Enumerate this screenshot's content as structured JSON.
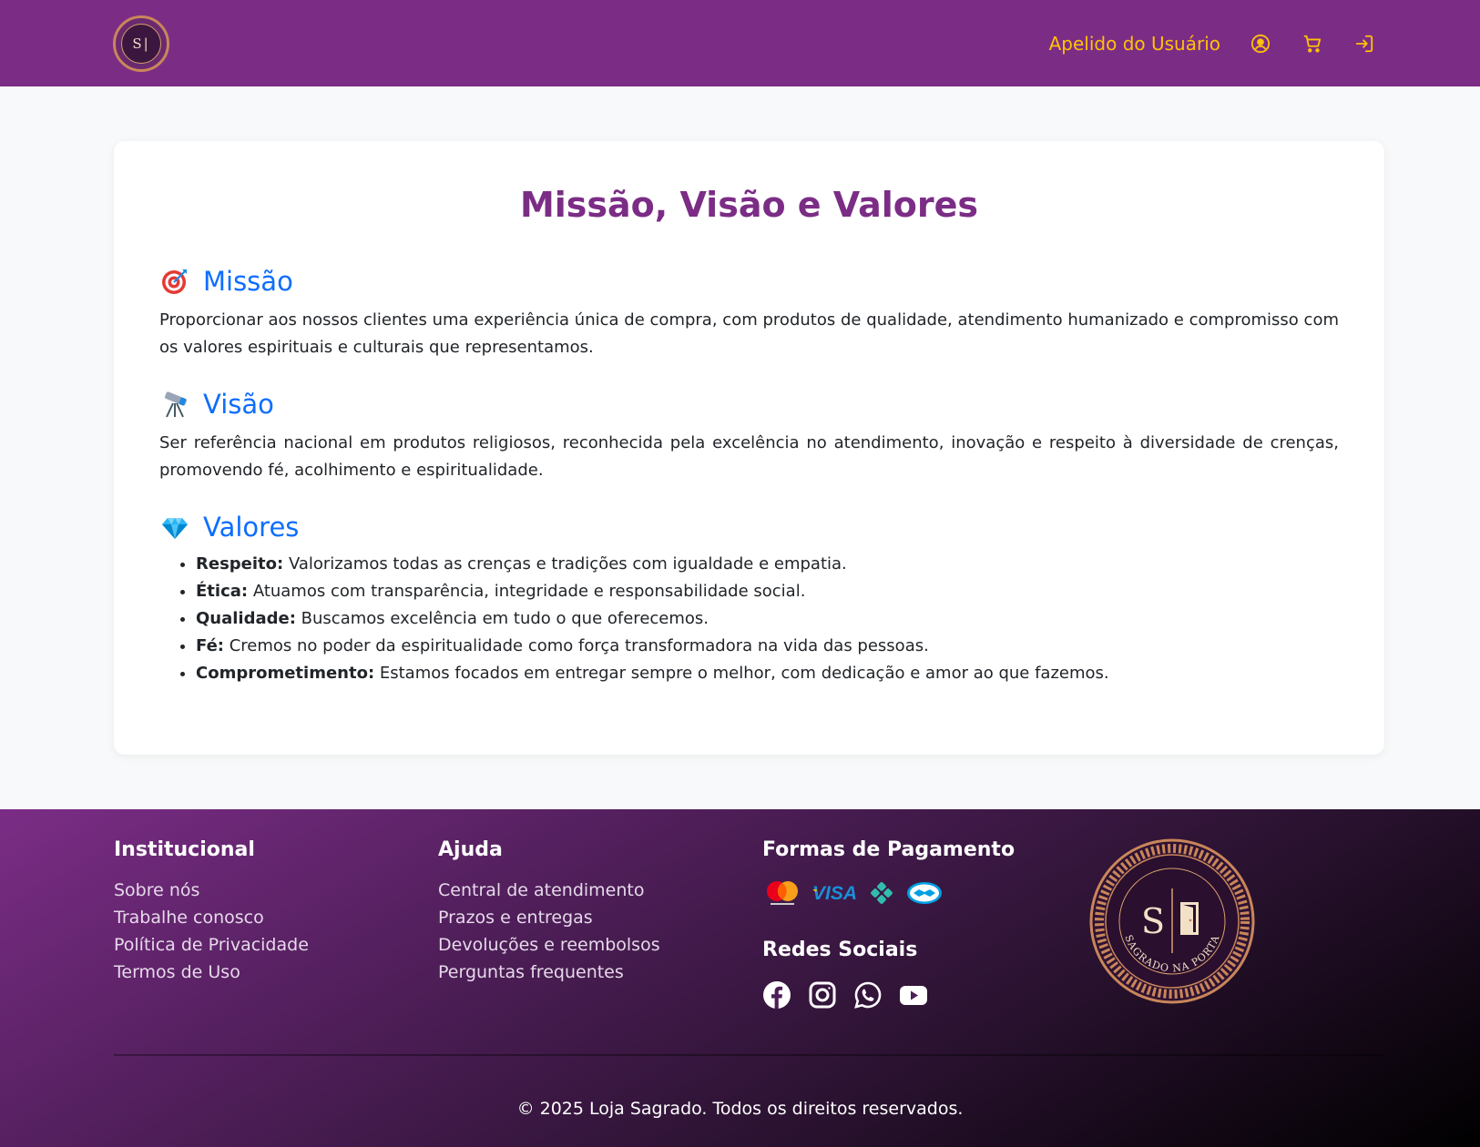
{
  "header": {
    "logo_alt": "S|",
    "user_nickname": "Apelido do Usuário",
    "icons": [
      "user-circle-icon",
      "cart-icon",
      "login-icon"
    ],
    "background": "#7b2d86",
    "accent": "#ffc107"
  },
  "main": {
    "title": "Missão, Visão e Valores",
    "mission": {
      "emoji": "🎯",
      "title": "Missão",
      "text": "Proporcionar aos nossos clientes uma experiência única de compra, com produtos de qualidade, atendimento humanizado e compromisso com os valores espirituais e culturais que representamos."
    },
    "vision": {
      "emoji": "🔭",
      "title": "Visão",
      "text": "Ser referência nacional em produtos religiosos, reconhecida pela excelência no atendimento, inovação e respeito à diversidade de crenças, promovendo fé, acolhimento e espiritualidade."
    },
    "values": {
      "emoji": "💎",
      "title": "Valores",
      "items": [
        {
          "term": "Respeito:",
          "desc": " Valorizamos todas as crenças e tradições com igualdade e empatia."
        },
        {
          "term": "Ética:",
          "desc": " Atuamos com transparência, integridade e responsabilidade social."
        },
        {
          "term": "Qualidade:",
          "desc": " Buscamos excelência em tudo o que oferecemos."
        },
        {
          "term": "Fé:",
          "desc": " Cremos no poder da espiritualidade como força transformadora na vida das pessoas."
        },
        {
          "term": "Comprometimento:",
          "desc": " Estamos focados em entregar sempre o melhor, com dedicação e amor ao que fazemos."
        }
      ]
    }
  },
  "footer": {
    "institutional": {
      "title": "Institucional",
      "links": [
        "Sobre nós",
        "Trabalhe conosco",
        "Política de Privacidade",
        "Termos de Uso"
      ]
    },
    "help": {
      "title": "Ajuda",
      "links": [
        "Central de atendimento",
        "Prazos e entregas",
        "Devoluções e reembolsos",
        "Perguntas frequentes"
      ]
    },
    "payment": {
      "title": "Formas de Pagamento",
      "methods": [
        "mastercard-icon",
        "visa-icon",
        "pix-icon",
        "mercadopago-icon"
      ],
      "visa_text": "VISA"
    },
    "social": {
      "title": "Redes Sociais",
      "icons": [
        "facebook-icon",
        "instagram-icon",
        "whatsapp-icon",
        "youtube-icon"
      ]
    },
    "brand_logo": {
      "monogram": "S",
      "ring_text": "SAGRADO NA PORTA"
    },
    "copyright": "© 2025 Loja Sagrado. Todos os direitos reservados."
  }
}
